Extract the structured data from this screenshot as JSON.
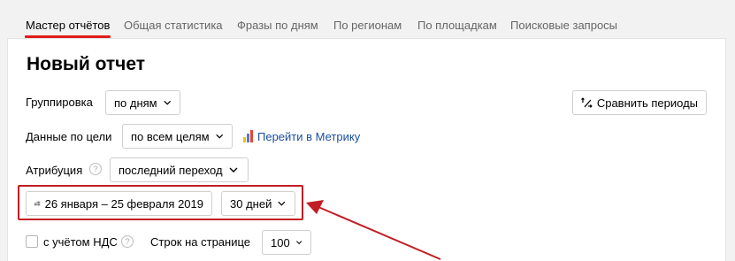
{
  "tabs": [
    {
      "label": "Мастер отчётов",
      "active": true
    },
    {
      "label": "Общая статистика"
    },
    {
      "label": "Фразы по дням"
    },
    {
      "label": "По регионам"
    },
    {
      "label": "По площадкам"
    },
    {
      "label": "Поисковые запросы"
    }
  ],
  "page_title": "Новый отчет",
  "grouping": {
    "label": "Группировка",
    "value": "по дням",
    "icon": "chevron-down-icon"
  },
  "compare": {
    "label": "Сравнить периоды",
    "icon": "compare-periods-icon"
  },
  "goals": {
    "label": "Данные по цели",
    "value": "по всем целям",
    "icon": "chevron-down-icon"
  },
  "metrika_link": {
    "label": "Перейти в Метрику",
    "icon": "metrika-icon"
  },
  "attribution": {
    "label": "Атрибуция",
    "help": "?",
    "value": "последний переход",
    "icon": "chevron-down-icon"
  },
  "date_range": {
    "label": "26 января – 25 февраля 2019",
    "icon": "calendar-icon"
  },
  "period": {
    "value": "30 дней",
    "icon": "chevron-down-icon"
  },
  "vat": {
    "label": "с учётом НДС",
    "help": "?",
    "checked": false
  },
  "rows_per_page": {
    "label": "Строк на странице",
    "value": "100",
    "icon": "chevron-down-icon"
  },
  "colors": {
    "accent": "#e31b1b",
    "annotation": "#c21d24",
    "link": "#1a4fa0",
    "metrika": [
      "#f5c200",
      "#4a7de0",
      "#e8452c"
    ]
  }
}
